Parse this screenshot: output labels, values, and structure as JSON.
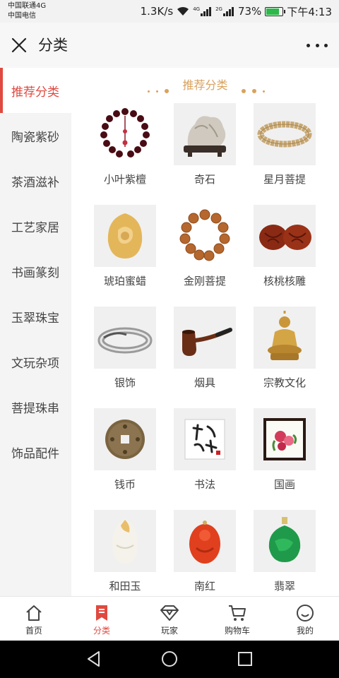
{
  "status_bar": {
    "carrier1": "中国联通4G",
    "carrier2": "中国电信",
    "speed": "1.3K/s",
    "net1": "4G",
    "net2": "2G",
    "battery": "73%",
    "time": "下午4:13"
  },
  "header": {
    "title": "分类"
  },
  "sidebar": {
    "items": [
      {
        "label": "推荐分类"
      },
      {
        "label": "陶瓷紫砂"
      },
      {
        "label": "茶酒滋补"
      },
      {
        "label": "工艺家居"
      },
      {
        "label": "书画篆刻"
      },
      {
        "label": "玉翠珠宝"
      },
      {
        "label": "文玩杂项"
      },
      {
        "label": "菩提珠串"
      },
      {
        "label": "饰品配件"
      }
    ]
  },
  "content": {
    "section_title": "推荐分类",
    "categories": [
      {
        "label": "小叶紫檀",
        "icon": "sandalwood-beads-icon"
      },
      {
        "label": "奇石",
        "icon": "rock-icon"
      },
      {
        "label": "星月菩提",
        "icon": "bodhi-bracelet-icon"
      },
      {
        "label": "琥珀蜜蜡",
        "icon": "amber-icon"
      },
      {
        "label": "金刚菩提",
        "icon": "rudraksha-beads-icon"
      },
      {
        "label": "核桃核雕",
        "icon": "walnut-icon"
      },
      {
        "label": "银饰",
        "icon": "silver-bangle-icon"
      },
      {
        "label": "烟具",
        "icon": "pipe-icon"
      },
      {
        "label": "宗教文化",
        "icon": "buddha-statue-icon"
      },
      {
        "label": "钱币",
        "icon": "coin-icon"
      },
      {
        "label": "书法",
        "icon": "calligraphy-icon"
      },
      {
        "label": "国画",
        "icon": "painting-icon"
      },
      {
        "label": "和田玉",
        "icon": "jade-pendant-icon"
      },
      {
        "label": "南红",
        "icon": "red-agate-icon"
      },
      {
        "label": "翡翠",
        "icon": "jadeite-pendant-icon"
      }
    ]
  },
  "tabbar": {
    "items": [
      {
        "label": "首页",
        "icon": "home-icon"
      },
      {
        "label": "分类",
        "icon": "category-bookmark-icon"
      },
      {
        "label": "玩家",
        "icon": "diamond-icon"
      },
      {
        "label": "购物车",
        "icon": "cart-icon"
      },
      {
        "label": "我的",
        "icon": "smile-icon"
      }
    ]
  },
  "colors": {
    "accent": "#e0493f",
    "section_gold": "#d9a25e",
    "sidebar_bg": "#f4f4f4"
  }
}
